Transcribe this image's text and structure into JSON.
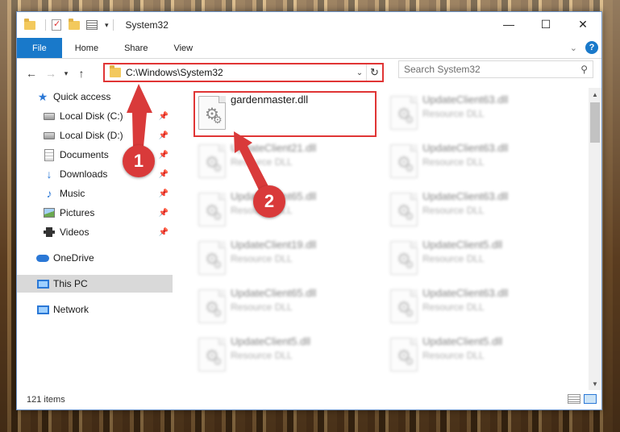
{
  "window": {
    "title": "System32",
    "controls": {
      "minimize": "—",
      "maximize": "☐",
      "close": "✕"
    }
  },
  "ribbon": {
    "tabs": [
      "File",
      "Home",
      "Share",
      "View"
    ],
    "help_label": "?"
  },
  "nav": {
    "address": "C:\\Windows\\System32",
    "search_placeholder": "Search System32"
  },
  "sidebar": {
    "items": [
      {
        "label": "Quick access",
        "icon": "star-icon",
        "pinned": false
      },
      {
        "label": "Local Disk (C:)",
        "icon": "drive-icon",
        "pinned": true
      },
      {
        "label": "Local Disk (D:)",
        "icon": "drive-icon",
        "pinned": true
      },
      {
        "label": "Documents",
        "icon": "documents-icon",
        "pinned": true
      },
      {
        "label": "Downloads",
        "icon": "download-icon",
        "pinned": true
      },
      {
        "label": "Music",
        "icon": "music-icon",
        "pinned": true
      },
      {
        "label": "Pictures",
        "icon": "pictures-icon",
        "pinned": true
      },
      {
        "label": "Videos",
        "icon": "videos-icon",
        "pinned": true
      },
      {
        "label": "OneDrive",
        "icon": "cloud-icon",
        "pinned": false
      },
      {
        "label": "This PC",
        "icon": "computer-icon",
        "pinned": false,
        "selected": true
      },
      {
        "label": "Network",
        "icon": "network-icon",
        "pinned": false
      }
    ]
  },
  "files": [
    {
      "name": "gardenmaster.dll",
      "type": "",
      "highlighted": true
    },
    {
      "name": "UpdateClient63.dll",
      "type": "Resource DLL"
    },
    {
      "name": "UpdateClient21.dll",
      "type": "Resource DLL"
    },
    {
      "name": "UpdateClient63.dll",
      "type": "Resource DLL"
    },
    {
      "name": "UpdateClient65.dll",
      "type": "Resource DLL"
    },
    {
      "name": "UpdateClient63.dll",
      "type": "Resource DLL"
    },
    {
      "name": "UpdateClient19.dll",
      "type": "Resource DLL"
    },
    {
      "name": "UpdateClient5.dll",
      "type": "Resource DLL"
    },
    {
      "name": "UpdateClient65.dll",
      "type": "Resource DLL"
    },
    {
      "name": "UpdateClient63.dll",
      "type": "Resource DLL"
    },
    {
      "name": "UpdateClient5.dll",
      "type": "Resource DLL"
    },
    {
      "name": "UpdateClient5.dll",
      "type": "Resource DLL"
    }
  ],
  "status": {
    "item_count": "121 items"
  },
  "annotations": {
    "step1": "1",
    "step2": "2",
    "color": "#d93a3a"
  }
}
